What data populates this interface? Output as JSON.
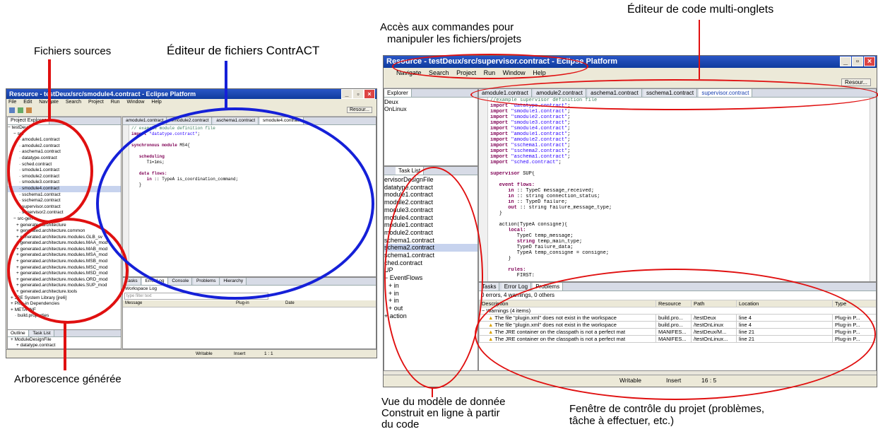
{
  "annotations": {
    "fichiers_sources": "Fichiers sources",
    "editeur_contract": "Éditeur de fichiers ContrACT",
    "arborescence": "Arborescence générée",
    "acces_1": "Accès aux commandes pour",
    "acces_2": "manipuler les fichiers/projets",
    "editeur_multi": "Éditeur de code multi-onglets",
    "vue_1": "Vue du modèle de donnée",
    "vue_2": "Construit en ligne à partir",
    "vue_3": "du code",
    "fenetre_1": "Fenêtre de contrôle du projet (problèmes,",
    "fenetre_2": "tâche à effectuer, etc.)"
  },
  "colors": {
    "red": "#e01010",
    "blue": "#1520d8",
    "title": "#1a4bb8"
  },
  "left_window": {
    "title": "Resource - testDeux/src/smodule4.contract - Eclipse Platform",
    "menu": [
      "File",
      "Edit",
      "Navigate",
      "Search",
      "Project",
      "Run",
      "Window",
      "Help"
    ],
    "resource_button": "Resour...",
    "explorer_tab": "Project Explorer",
    "tree": [
      "testDeux",
      "src",
      "amodule1.contract",
      "amodule2.contract",
      "aschema1.contract",
      "datatype.contract",
      "sched.contract",
      "smodule1.contract",
      "smodule2.contract",
      "smodule3.contract",
      "smodule4.contract",
      "sschema1.contract",
      "sschema2.contract",
      "supervisor.contract",
      "supervisor2.contract",
      "src-gen",
      "generated.architecture",
      "generated.architecture.common",
      "generated.architecture.modules.GLB_sv",
      "generated.architecture.modules.MAA_mod",
      "generated.architecture.modules.MAB_mod",
      "generated.architecture.modules.MSA_mod",
      "generated.architecture.modules.MSB_mod",
      "generated.architecture.modules.MSC_mod",
      "generated.architecture.modules.MSD_mod",
      "generated.architecture.modules.ORD_mod",
      "generated.architecture.modules.SUP_mod",
      "generated.architecture.tools",
      "JRE System Library [jre6]",
      "Plug-in Dependencies",
      "META-INF",
      "build.properties"
    ],
    "editor_tabs": [
      "amodule1.contract",
      "smodule2.contract",
      "aschema1.contract",
      "smodule4.contract"
    ],
    "code": [
      "// example module definition file",
      "import \"datatype.contract\";",
      "",
      "synchronous module MS4{",
      "",
      "   scheduling",
      "      T1=1ms;",
      "",
      "   data flows:",
      "      in :: TypeA is_coordination_command;",
      "   }"
    ],
    "bottom_tabs": [
      "Tasks",
      "Error Log",
      "Console",
      "Problems",
      "Hierarchy"
    ],
    "workspace_log": "Workspace Log",
    "filter": "type filter text",
    "log_cols": [
      "Message",
      "Plug-in",
      "Date"
    ],
    "outline_tabs": [
      "Outline",
      "Task List"
    ],
    "outline_items": [
      "ModuleDesignFile",
      "datatype.contract"
    ],
    "status": [
      "Writable",
      "Insert",
      "1 : 1"
    ]
  },
  "right_window": {
    "title": "Resource - testDeux/src/supervisor.contract - Eclipse Platform",
    "menu": [
      "Navigate",
      "Search",
      "Project",
      "Run",
      "Window",
      "Help"
    ],
    "resource_button": "Resour...",
    "explorer_tab": "Explorer",
    "explorer_items": [
      "Deux",
      "OnLinux"
    ],
    "editor_tabs": [
      "amodule1.contract",
      "amodule2.contract",
      "aschema1.contract",
      "sschema1.contract",
      "supervisor.contract"
    ],
    "code": [
      "//example supervisor definition file",
      "import \"datatype.contract\";",
      "import \"smodule1.contract\";",
      "import \"smodule2.contract\";",
      "import \"smodule3.contract\";",
      "import \"smodule4.contract\";",
      "import \"amodule1.contract\";",
      "import \"amodule2.contract\";",
      "import \"sschema1.contract\";",
      "import \"sschema2.contract\";",
      "import \"aschema1.contract\";",
      "import \"sched.contract\";",
      "",
      "supervisor SUP{",
      "",
      "   event flows:",
      "      in :: TypeC message_received;",
      "      in :: string connection_status;",
      "      in :: TypeD failure;",
      "      out :: string failure_message_type;",
      "   }",
      "",
      "   action(TypeA consigne){",
      "      local:",
      "         TypeC temp_message;",
      "         string temp_main_type;",
      "         TypeD failure_data;",
      "         TypeA temp_consigne = consigne;",
      "      }",
      "",
      "      rules:",
      "         FIRST:"
    ],
    "tasklist_tab": "Task List",
    "tasklist_items": [
      "ervisorDesignFile",
      "datatype.contract",
      "module1.contract",
      "module2.contract",
      "module3.contract",
      "module4.contract",
      "module1.contract",
      "module2.contract",
      "schema1.contract",
      "schema2.contract",
      "schema1.contract",
      "ched.contract",
      "UP",
      "EventFlows",
      "in",
      "in",
      "in",
      "out",
      "action"
    ],
    "bottom_tabs": [
      "Tasks",
      "Error Log",
      "Problems"
    ],
    "summary": "0 errors, 4 warnings, 0 others",
    "prob_headers": [
      "Description",
      "Resource",
      "Path",
      "Location",
      "Type"
    ],
    "warn_group": "Warnings (4 items)",
    "rows": [
      [
        "The file \"plugin.xml\" does not exist in the workspace",
        "build.pro...",
        "/testDeux",
        "line 4",
        "Plug-in P..."
      ],
      [
        "The file \"plugin.xml\" does not exist in the workspace",
        "build.pro...",
        "/testOnLinux",
        "line 4",
        "Plug-in P..."
      ],
      [
        "The JRE container on the classpath is not a perfect mat",
        "MANIFES...",
        "/testDeux/M...",
        "line 21",
        "Plug-in P..."
      ],
      [
        "The JRE container on the classpath is not a perfect mat",
        "MANIFES...",
        "/testOnLinux...",
        "line 21",
        "Plug-in P..."
      ]
    ],
    "status": [
      "Writable",
      "Insert",
      "16 : 5"
    ]
  }
}
